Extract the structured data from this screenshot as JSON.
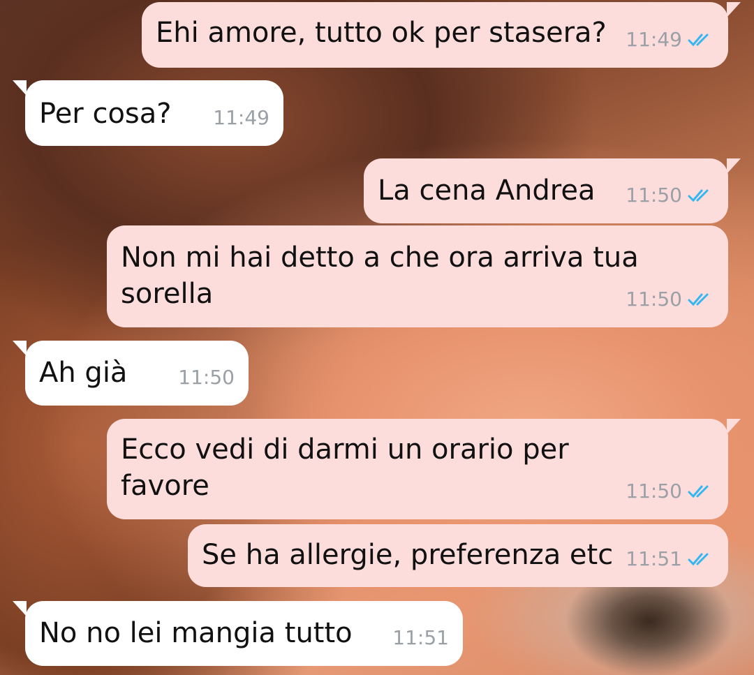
{
  "messages": [
    {
      "text": "Ehi amore, tutto ok per stasera?",
      "time": "11:49",
      "direction": "out",
      "read": true
    },
    {
      "text": "Per cosa?",
      "time": "11:49",
      "direction": "in"
    },
    {
      "text": "La cena Andrea",
      "time": "11:50",
      "direction": "out",
      "read": true
    },
    {
      "text": "Non mi hai detto a che ora arriva tua\nsorella",
      "time": "11:50",
      "direction": "out",
      "read": true
    },
    {
      "text": "Ah già",
      "time": "11:50",
      "direction": "in"
    },
    {
      "text": "Ecco vedi di darmi un orario per favore",
      "time": "11:50",
      "direction": "out",
      "read": true
    },
    {
      "text": "Se ha allergie, preferenza etc",
      "time": "11:51",
      "direction": "out",
      "read": true
    },
    {
      "text": "No no lei mangia tutto",
      "time": "11:51",
      "direction": "in"
    }
  ],
  "colors": {
    "outgoing_bubble": "#fddcdc",
    "incoming_bubble": "#ffffff",
    "read_ticks": "#34b7f1",
    "timestamp": "#9aa0a6"
  },
  "icons": {
    "read_receipt": "double-check-icon"
  }
}
